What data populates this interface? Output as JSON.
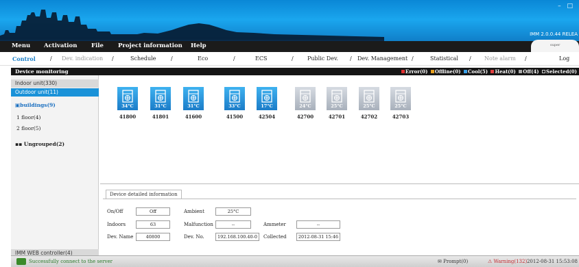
{
  "window": {
    "controls": "– □",
    "version": "IMM 2.0.0.44 RELEA"
  },
  "menu": [
    {
      "label": "Menu",
      "x_name": "menu"
    },
    {
      "label": "Activation",
      "x_name": "activation"
    },
    {
      "label": "File",
      "x_name": "file"
    },
    {
      "label": "Project information",
      "x_name": "project-information"
    },
    {
      "label": "Help",
      "x_name": "help"
    }
  ],
  "user_tab": "super",
  "nav": {
    "control": "Control",
    "dev_indication": "Dev. indication",
    "schedule": "Schedule",
    "eco": "Eco",
    "ecs": "ECS",
    "public_dev": "Public Dev.",
    "dev_management": "Dev. Management",
    "statistical": "Statistical",
    "note_alarm": "Note alarm",
    "log": "Log",
    "sep": "/"
  },
  "monitoring": {
    "title": "Device monitoring",
    "legend": {
      "error": "Error(0)",
      "offline": "Offline(0)",
      "cool": "Cool(5)",
      "heat": "Heat(0)",
      "off": "Off(4)",
      "selected": "Selected(0)"
    },
    "colors": {
      "error": "#e03030",
      "offline": "#e8a020",
      "cool": "#3aa0e8",
      "heat": "#e04040",
      "off": "#aaaaaa"
    }
  },
  "sidebar": {
    "indoor": "Indoor unit(330)",
    "outdoor": "Outdoor unit(11)",
    "buildings": "buildings(9)",
    "buildings_icon": "▣",
    "floor1": "1 floor(4)",
    "floor2": "2 floor(5)",
    "ungrouped": "Ungrouped(2)",
    "ungrouped_icon": "▪▪",
    "web_controller": "IMM WEB controller(4)"
  },
  "units": [
    {
      "id": "41800",
      "temp": "34°C",
      "state": "on"
    },
    {
      "id": "41801",
      "temp": "31°C",
      "state": "on"
    },
    {
      "id": "41600",
      "temp": "31°C",
      "state": "on"
    },
    {
      "id": "41500",
      "temp": "33°C",
      "state": "on"
    },
    {
      "id": "42504",
      "temp": "17°C",
      "state": "on"
    },
    {
      "id": "42700",
      "temp": "24°C",
      "state": "off"
    },
    {
      "id": "42701",
      "temp": "25°C",
      "state": "off"
    },
    {
      "id": "42702",
      "temp": "25°C",
      "state": "off"
    },
    {
      "id": "42703",
      "temp": "25°C",
      "state": "off"
    }
  ],
  "detail": {
    "tab": "Device detailed information",
    "onoff_label": "On/Off",
    "onoff_value": "Off",
    "ambient_label": "Ambient",
    "ambient_value": "25°C",
    "indoors_label": "Indoors",
    "indoors_value": "63",
    "malfunction_label": "Malfunction",
    "malfunction_value": "--",
    "ammeter_label": "Ammeter",
    "ammeter_value": "--",
    "devname_label": "Dev. Name",
    "devname_value": "40800",
    "devno_label": "Dev. No.",
    "devno_value": "192.168.100.40-0",
    "collected_label": "Collected",
    "collected_value": "2012-08-31 15:46"
  },
  "status": {
    "message": "Successfully connect to the server",
    "prompt": "Prompt(0)",
    "warning": "Warning(132)",
    "time": "2012-08-31 15:53:08"
  }
}
